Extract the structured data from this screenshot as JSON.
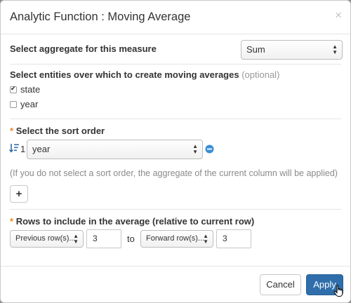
{
  "dialog": {
    "title": "Analytic Function : Moving Average",
    "close_glyph": "×"
  },
  "aggregate": {
    "label": "Select aggregate for this measure",
    "selected": "Sum"
  },
  "entities": {
    "label": "Select entities over which to create moving averages",
    "optional": "(optional)",
    "items": [
      {
        "label": "state",
        "checked": true
      },
      {
        "label": "year",
        "checked": false
      }
    ]
  },
  "sort": {
    "required_mark": "*",
    "label": "Select the sort order",
    "index": "1",
    "selected": "year",
    "sort_icon": "sort-ascending-icon",
    "remove_icon": "minus-circle-icon",
    "hint": "(If you do not select a sort order, the aggregate of the current column will be applied)",
    "add_glyph": "+"
  },
  "rows": {
    "required_mark": "*",
    "label": "Rows to include in the average (relative to current row)",
    "previous_selected": "Previous row(s)...",
    "previous_value": "3",
    "to_label": "to",
    "forward_selected": "Forward row(s)...",
    "forward_value": "3"
  },
  "footer": {
    "cancel_label": "Cancel",
    "apply_label": "Apply"
  },
  "colors": {
    "accent": "#2f6eab",
    "required": "#e8881e",
    "remove_icon": "#3b8fd4"
  }
}
